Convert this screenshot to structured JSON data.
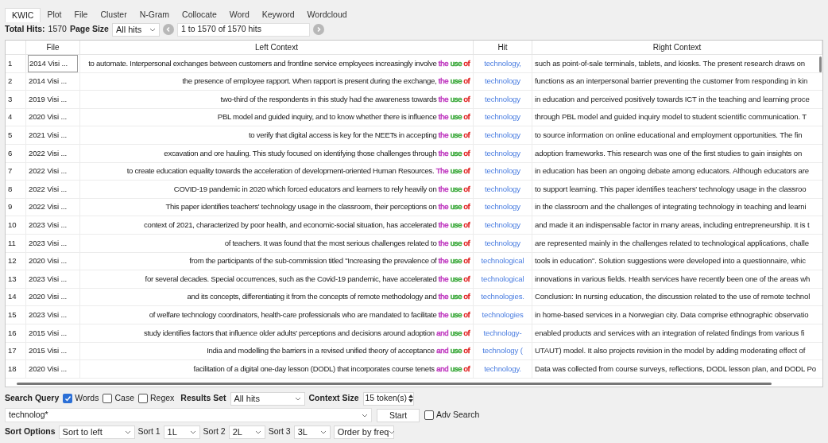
{
  "tabs": [
    {
      "label": "KWIC",
      "selected": true
    },
    {
      "label": "Plot",
      "selected": false
    },
    {
      "label": "File",
      "selected": false
    },
    {
      "label": "Cluster",
      "selected": false
    },
    {
      "label": "N-Gram",
      "selected": false
    },
    {
      "label": "Collocate",
      "selected": false
    },
    {
      "label": "Word",
      "selected": false
    },
    {
      "label": "Keyword",
      "selected": false
    },
    {
      "label": "Wordcloud",
      "selected": false
    }
  ],
  "toolbar": {
    "total_hits_label": "Total Hits:",
    "total_hits": "1570",
    "page_size_label": "Page Size",
    "page_size": "All hits",
    "range": "1 to 1570 of 1570 hits"
  },
  "table": {
    "columns": [
      "File",
      "Left Context",
      "Hit",
      "Right Context"
    ],
    "rows": [
      {
        "index": "1",
        "file": "2014 Visi ...",
        "selected": true,
        "left": "to automate. Interpersonal exchanges between customers and frontline service employees increasingly involve",
        "colloc": [
          {
            "text": "the",
            "color": "#c03cc0"
          },
          {
            "text": "use",
            "color": "#3aa83a"
          },
          {
            "text": "of",
            "color": "#e02020"
          }
        ],
        "hit": "technology,",
        "right": "such as point-of-sale terminals, tablets, and kiosks. The present research draws on"
      },
      {
        "index": "2",
        "file": "2014 Visi ...",
        "selected": false,
        "left": "the presence of employee rapport. When rapport is present during the exchange,",
        "colloc": [
          {
            "text": "the",
            "color": "#c03cc0"
          },
          {
            "text": "use",
            "color": "#3aa83a"
          },
          {
            "text": "of",
            "color": "#e02020"
          }
        ],
        "hit": "technology",
        "right": "functions as an interpersonal barrier preventing the customer from responding in kin"
      },
      {
        "index": "3",
        "file": "2019 Visi ...",
        "selected": false,
        "left": "two-third of the respondents in this study had the awareness towards",
        "colloc": [
          {
            "text": "the",
            "color": "#c03cc0"
          },
          {
            "text": "use",
            "color": "#3aa83a"
          },
          {
            "text": "of",
            "color": "#e02020"
          }
        ],
        "hit": "technology",
        "right": "in education and perceived positively towards ICT in the teaching and learning proce"
      },
      {
        "index": "4",
        "file": "2020 Visi ...",
        "selected": false,
        "left": "PBL model and guided inquiry, and to know whether there is influence",
        "colloc": [
          {
            "text": "the",
            "color": "#c03cc0"
          },
          {
            "text": "use",
            "color": "#3aa83a"
          },
          {
            "text": "of",
            "color": "#e02020"
          }
        ],
        "hit": "technology",
        "right": "through PBL model and guided inquiry model to student scientific communication. T"
      },
      {
        "index": "5",
        "file": "2021 Visi ...",
        "selected": false,
        "left": "to verify that digital access is key for the NEETs in accepting",
        "colloc": [
          {
            "text": "the",
            "color": "#c03cc0"
          },
          {
            "text": "use",
            "color": "#3aa83a"
          },
          {
            "text": "of",
            "color": "#e02020"
          }
        ],
        "hit": "technology",
        "right": "to source information on online educational and employment opportunities. The fin"
      },
      {
        "index": "6",
        "file": "2022 Visi ...",
        "selected": false,
        "left": "excavation and ore hauling. This study focused on identifying those challenges through",
        "colloc": [
          {
            "text": "the",
            "color": "#c03cc0"
          },
          {
            "text": "use",
            "color": "#3aa83a"
          },
          {
            "text": "of",
            "color": "#e02020"
          }
        ],
        "hit": "technology",
        "right": "adoption frameworks. This research was one of the first studies to gain insights on"
      },
      {
        "index": "7",
        "file": "2022 Visi ...",
        "selected": false,
        "left": "to create education equality towards the acceleration of development-oriented Human Resources.",
        "colloc": [
          {
            "text": "The",
            "color": "#c03cc0"
          },
          {
            "text": "use",
            "color": "#3aa83a"
          },
          {
            "text": "of",
            "color": "#e02020"
          }
        ],
        "hit": "technology",
        "right": "in education has been an ongoing debate among educators. Although educators are"
      },
      {
        "index": "8",
        "file": "2022 Visi ...",
        "selected": false,
        "left": "COVID-19 pandemic in 2020 which forced educators and learners to rely heavily on",
        "colloc": [
          {
            "text": "the",
            "color": "#c03cc0"
          },
          {
            "text": "use",
            "color": "#3aa83a"
          },
          {
            "text": "of",
            "color": "#e02020"
          }
        ],
        "hit": "technology",
        "right": "to support learning. This paper identifies teachers' technology usage in the classroo"
      },
      {
        "index": "9",
        "file": "2022 Visi ...",
        "selected": false,
        "left": "This paper identifies teachers' technology usage in the classroom, their perceptions on",
        "colloc": [
          {
            "text": "the",
            "color": "#c03cc0"
          },
          {
            "text": "use",
            "color": "#3aa83a"
          },
          {
            "text": "of",
            "color": "#e02020"
          }
        ],
        "hit": "technology",
        "right": "in the classroom and the challenges of integrating technology in teaching and learni"
      },
      {
        "index": "10",
        "file": "2023 Visi ...",
        "selected": false,
        "left": "context of 2021, characterized by poor health, and economic-social situation, has accelerated",
        "colloc": [
          {
            "text": "the",
            "color": "#c03cc0"
          },
          {
            "text": "use",
            "color": "#3aa83a"
          },
          {
            "text": "of",
            "color": "#e02020"
          }
        ],
        "hit": "technology",
        "right": "and made it an indispensable factor in many areas, including entrepreneurship. It is t"
      },
      {
        "index": "11",
        "file": "2023 Visi ...",
        "selected": false,
        "left": "of teachers. It was found that the most serious challenges related to",
        "colloc": [
          {
            "text": "the",
            "color": "#c03cc0"
          },
          {
            "text": "use",
            "color": "#3aa83a"
          },
          {
            "text": "of",
            "color": "#e02020"
          }
        ],
        "hit": "technology",
        "right": "are represented mainly in the challenges related to technological applications, challe"
      },
      {
        "index": "12",
        "file": "2020 Visi ...",
        "selected": false,
        "left": "from the participants of the sub-commission titled \"Increasing the prevalence of",
        "colloc": [
          {
            "text": "the",
            "color": "#c03cc0"
          },
          {
            "text": "use",
            "color": "#3aa83a"
          },
          {
            "text": "of",
            "color": "#e02020"
          }
        ],
        "hit": "technological",
        "right": "tools in education\". Solution suggestions were developed into a questionnaire, whic"
      },
      {
        "index": "13",
        "file": "2023 Visi ...",
        "selected": false,
        "left": "for several decades. Special occurrences, such as the Covid-19 pandemic, have accelerated",
        "colloc": [
          {
            "text": "the",
            "color": "#c03cc0"
          },
          {
            "text": "use",
            "color": "#3aa83a"
          },
          {
            "text": "of",
            "color": "#e02020"
          }
        ],
        "hit": "technological",
        "right": "innovations in various fields. Health services have recently been one of the areas wh"
      },
      {
        "index": "14",
        "file": "2020 Visi ...",
        "selected": false,
        "left": "and its concepts, differentiating it from the concepts of remote methodology and",
        "colloc": [
          {
            "text": "the",
            "color": "#c03cc0"
          },
          {
            "text": "use",
            "color": "#3aa83a"
          },
          {
            "text": "of",
            "color": "#e02020"
          }
        ],
        "hit": "technologies.",
        "right": "Conclusion: In nursing education, the discussion related to the use of remote technol"
      },
      {
        "index": "15",
        "file": "2023 Visi ...",
        "selected": false,
        "left": "of welfare technology coordinators, health-care professionals who are mandated to facilitate",
        "colloc": [
          {
            "text": "the",
            "color": "#c03cc0"
          },
          {
            "text": "use",
            "color": "#3aa83a"
          },
          {
            "text": "of",
            "color": "#e02020"
          }
        ],
        "hit": "technologies",
        "right": "in home-based services in a Norwegian city. Data comprise ethnographic observatio"
      },
      {
        "index": "16",
        "file": "2015 Visi ...",
        "selected": false,
        "left": "study identifies factors that influence older adults' perceptions and decisions around adoption",
        "colloc": [
          {
            "text": "and",
            "color": "#c03cc0"
          },
          {
            "text": "use",
            "color": "#3aa83a"
          },
          {
            "text": "of",
            "color": "#e02020"
          }
        ],
        "hit": "technology-",
        "right": "enabled products and services with an integration of related findings from various fi"
      },
      {
        "index": "17",
        "file": "2015 Visi ...",
        "selected": false,
        "left": "India and modelling the barriers in a revised unified theory of acceptance",
        "colloc": [
          {
            "text": "and",
            "color": "#c03cc0"
          },
          {
            "text": "use",
            "color": "#3aa83a"
          },
          {
            "text": "of",
            "color": "#e02020"
          }
        ],
        "hit": "technology (",
        "right": "UTAUT) model. It also projects revision in the model by adding moderating effect of"
      },
      {
        "index": "18",
        "file": "2020 Visi ...",
        "selected": false,
        "left": "facilitation of a digital one-day lesson (DODL) that incorporates course tenets",
        "colloc": [
          {
            "text": "and",
            "color": "#c03cc0"
          },
          {
            "text": "use",
            "color": "#3aa83a"
          },
          {
            "text": "of",
            "color": "#e02020"
          }
        ],
        "hit": "technology.",
        "right": "Data was collected from course surveys, reflections, DODL lesson plan, and DODL Po"
      }
    ]
  },
  "search": {
    "label": "Search Query",
    "options": [
      {
        "label": "Words",
        "checked": true
      },
      {
        "label": "Case",
        "checked": false
      },
      {
        "label": "Regex",
        "checked": false
      }
    ],
    "results_set_label": "Results Set",
    "results_set": "All hits",
    "context_size_label": "Context Size",
    "context_size": "15 token(s)",
    "query": "technolog*",
    "start": "Start",
    "adv_search": {
      "label": "Adv Search",
      "checked": false
    }
  },
  "sort": {
    "label": "Sort Options",
    "mode": "Sort to left",
    "sorts": [
      {
        "label": "Sort 1",
        "value": "1L"
      },
      {
        "label": "Sort 2",
        "value": "2L"
      },
      {
        "label": "Sort 3",
        "value": "3L"
      }
    ],
    "order": "Order by freq"
  }
}
